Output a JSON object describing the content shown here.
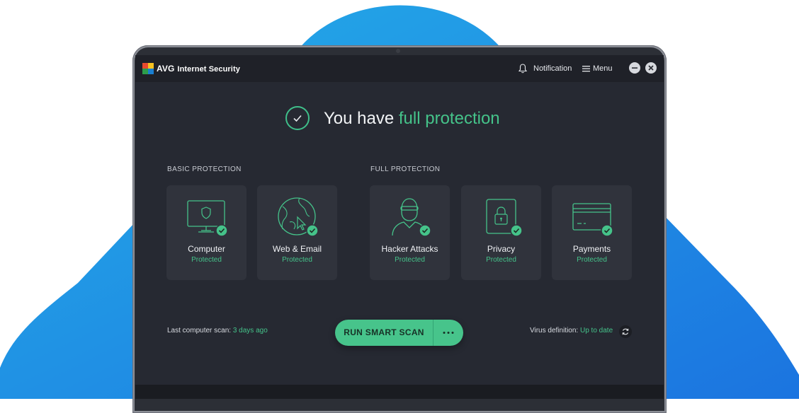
{
  "app": {
    "brand": "AVG",
    "title": "Internet Security"
  },
  "titlebar": {
    "notification_label": "Notification",
    "menu_label": "Menu"
  },
  "status": {
    "prefix": "You have",
    "highlight": "full protection"
  },
  "sections": {
    "basic_label": "BASIC PROTECTION",
    "full_label": "FULL PROTECTION"
  },
  "cards": [
    {
      "title": "Computer",
      "status": "Protected",
      "icon": "computer-shield-icon"
    },
    {
      "title": "Web & Email",
      "status": "Protected",
      "icon": "globe-icon"
    },
    {
      "title": "Hacker Attacks",
      "status": "Protected",
      "icon": "hacker-icon"
    },
    {
      "title": "Privacy",
      "status": "Protected",
      "icon": "lock-icon"
    },
    {
      "title": "Payments",
      "status": "Protected",
      "icon": "credit-card-icon"
    }
  ],
  "footer": {
    "last_scan_label": "Last computer scan:",
    "last_scan_value": "3 days ago",
    "scan_button_label": "RUN SMART SCAN",
    "more_options": "···",
    "virus_def_label": "Virus definition:",
    "virus_def_value": "Up to date"
  },
  "colors": {
    "accent": "#45c38a",
    "screen_bg": "#262932",
    "card_bg": "#30333c",
    "backdrop_blue": "#1f93e6"
  }
}
